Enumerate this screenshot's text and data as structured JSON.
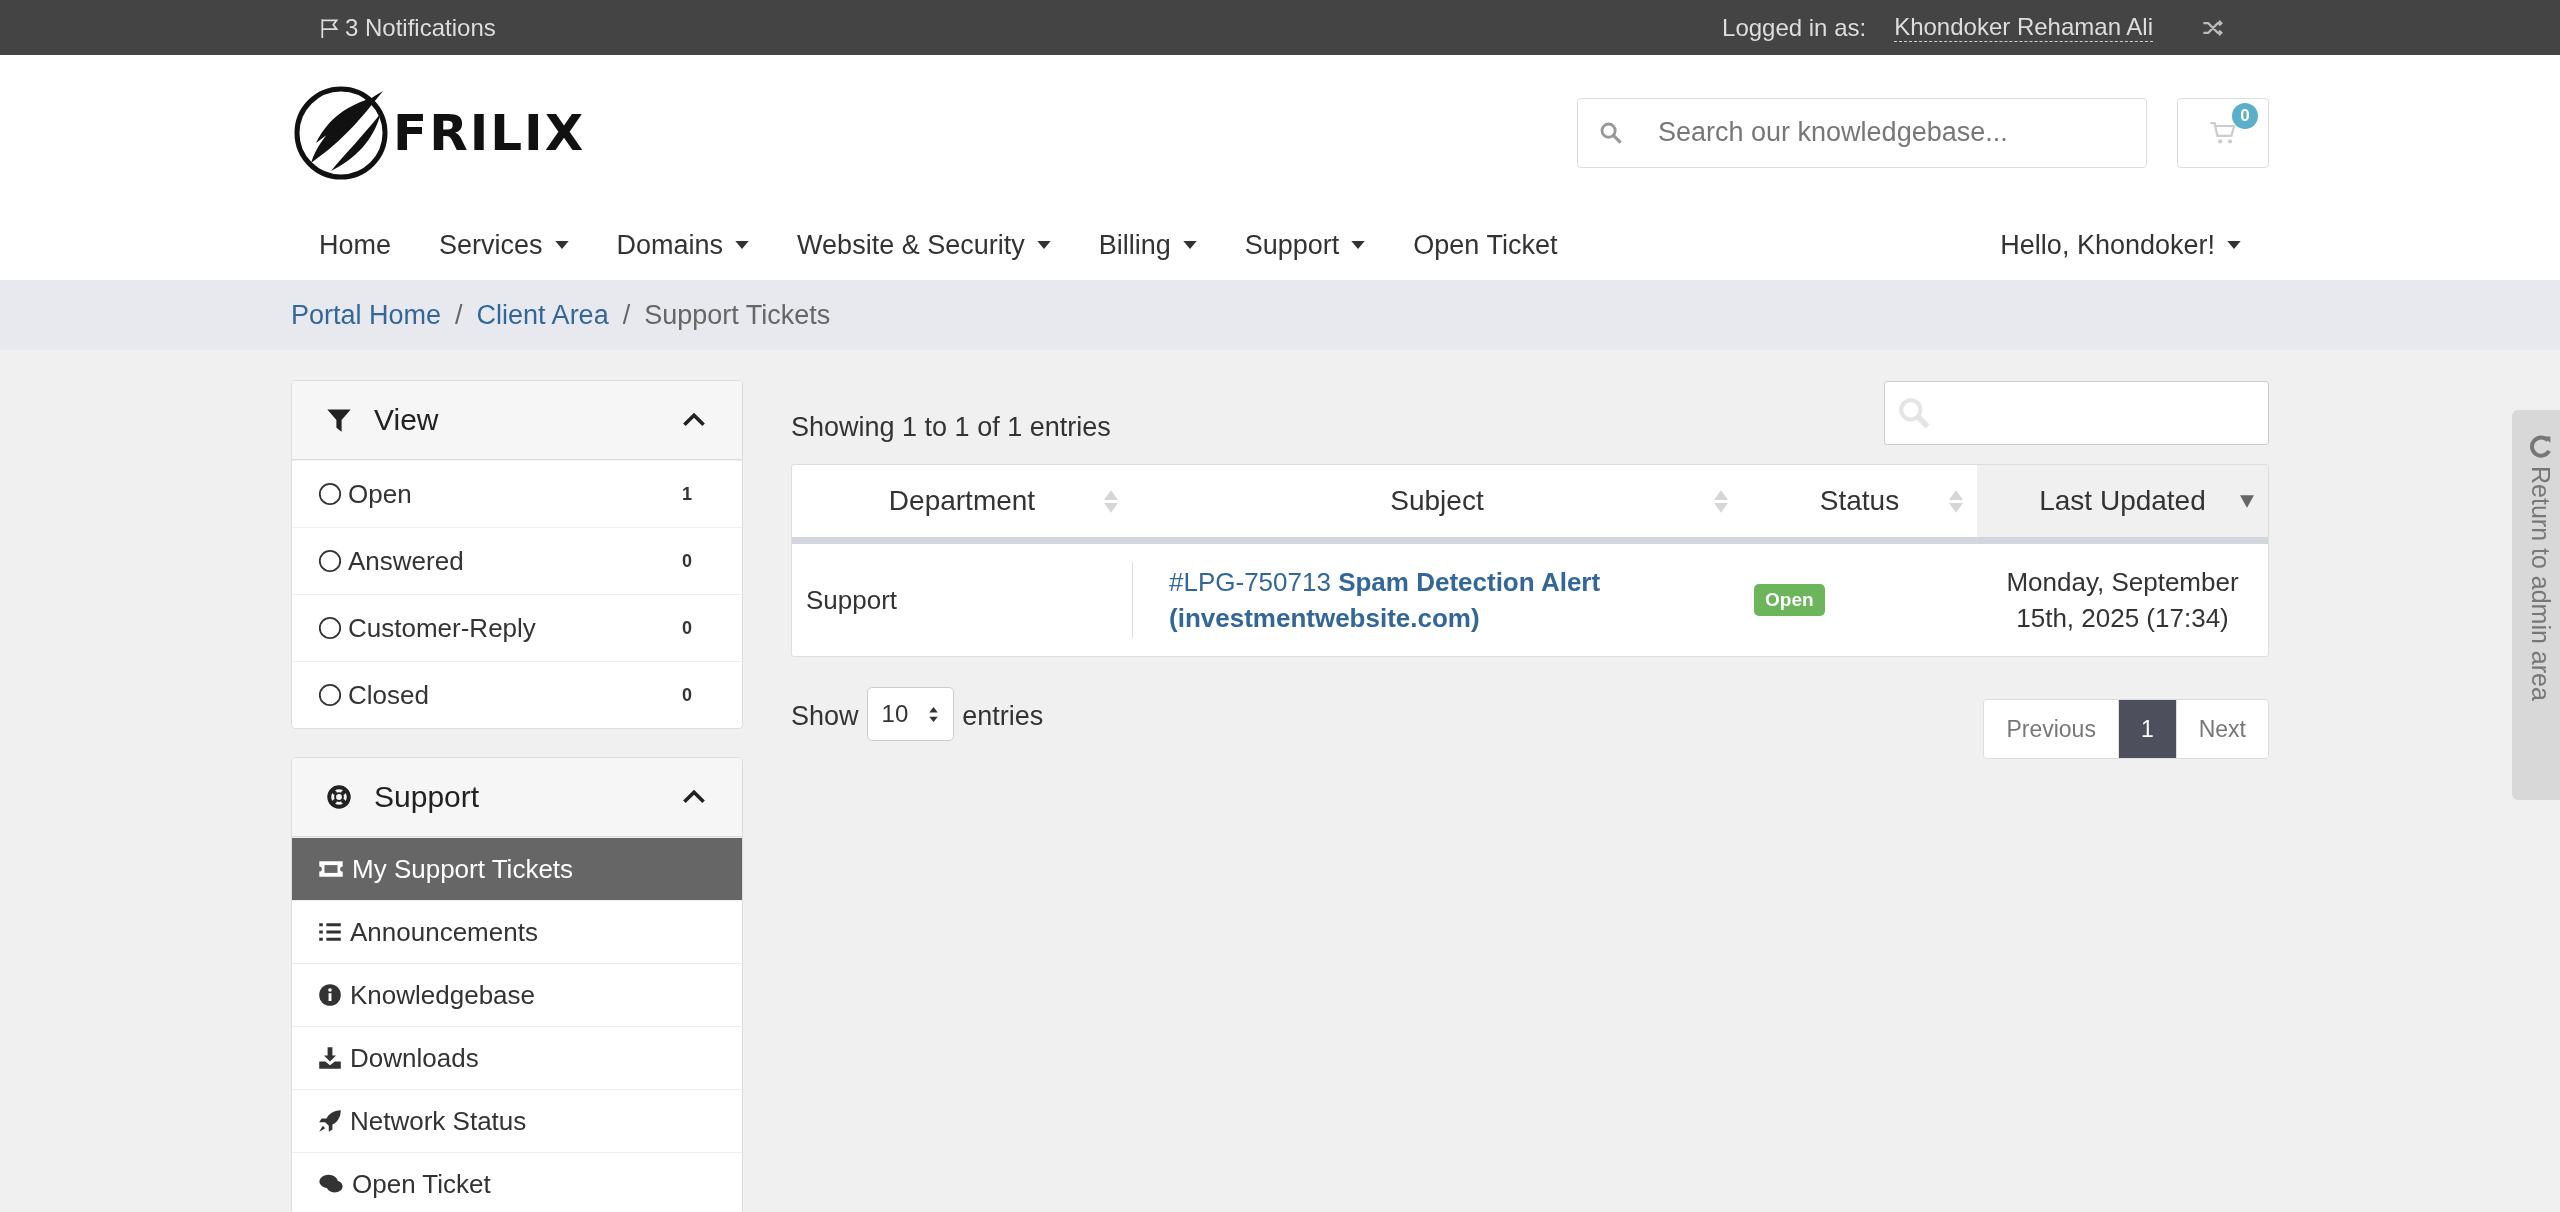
{
  "topbar": {
    "notifications": "3 Notifications",
    "logged_in_label": "Logged in as:",
    "user_name": "Khondoker Rehaman Ali"
  },
  "header": {
    "logo_text": "FRILIX",
    "search": {
      "placeholder": "Search our knowledgebase..."
    },
    "cart_count": "0"
  },
  "nav": {
    "items": [
      {
        "label": "Home",
        "dropdown": false
      },
      {
        "label": "Services",
        "dropdown": true
      },
      {
        "label": "Domains",
        "dropdown": true
      },
      {
        "label": "Website & Security",
        "dropdown": true
      },
      {
        "label": "Billing",
        "dropdown": true
      },
      {
        "label": "Support",
        "dropdown": true
      },
      {
        "label": "Open Ticket",
        "dropdown": false
      }
    ],
    "account": "Hello, Khondoker!"
  },
  "breadcrumb": [
    {
      "label": "Portal Home",
      "link": true
    },
    {
      "separator": "/",
      "label": "Client Area",
      "link": true
    },
    {
      "separator": "/",
      "label": "Support Tickets",
      "link": false
    }
  ],
  "sidebar": {
    "view": {
      "title": "View",
      "expanded": true,
      "filters": [
        {
          "label": "Open",
          "count": "1",
          "selected": false
        },
        {
          "label": "Answered",
          "count": "0",
          "selected": false
        },
        {
          "label": "Customer-Reply",
          "count": "0",
          "selected": false
        },
        {
          "label": "Closed",
          "count": "0",
          "selected": false
        }
      ]
    },
    "support": {
      "title": "Support",
      "expanded": true,
      "items": [
        {
          "label": "My Support Tickets",
          "selected": true
        },
        {
          "label": "Announcements",
          "selected": false
        },
        {
          "label": "Knowledgebase",
          "selected": false
        },
        {
          "label": "Downloads",
          "selected": false
        },
        {
          "label": "Network Status",
          "selected": false
        },
        {
          "label": "Open Ticket",
          "selected": false
        }
      ]
    }
  },
  "table": {
    "info": "Showing 1 to 1 of 1 entries",
    "columns": [
      {
        "label": "Department",
        "sorted": false
      },
      {
        "label": "Subject",
        "sorted": false
      },
      {
        "label": "Status",
        "sorted": false
      },
      {
        "label": "Last Updated",
        "sorted": true
      }
    ],
    "rows": [
      {
        "department": "Support",
        "ticket_id": "#LPG-750713",
        "subject": "Spam Detection Alert (investmentwebsite.com)",
        "status": "Open",
        "last_updated": "Monday, September 15th, 2025 (17:34)"
      }
    ],
    "show_label": "Show",
    "page_size": "10",
    "entries_label": "entries",
    "pagination": [
      {
        "label": "Previous",
        "selected": false
      },
      {
        "label": "1",
        "selected": true
      },
      {
        "label": "Next",
        "selected": false
      }
    ]
  },
  "admin_tab": "Return to admin area"
}
